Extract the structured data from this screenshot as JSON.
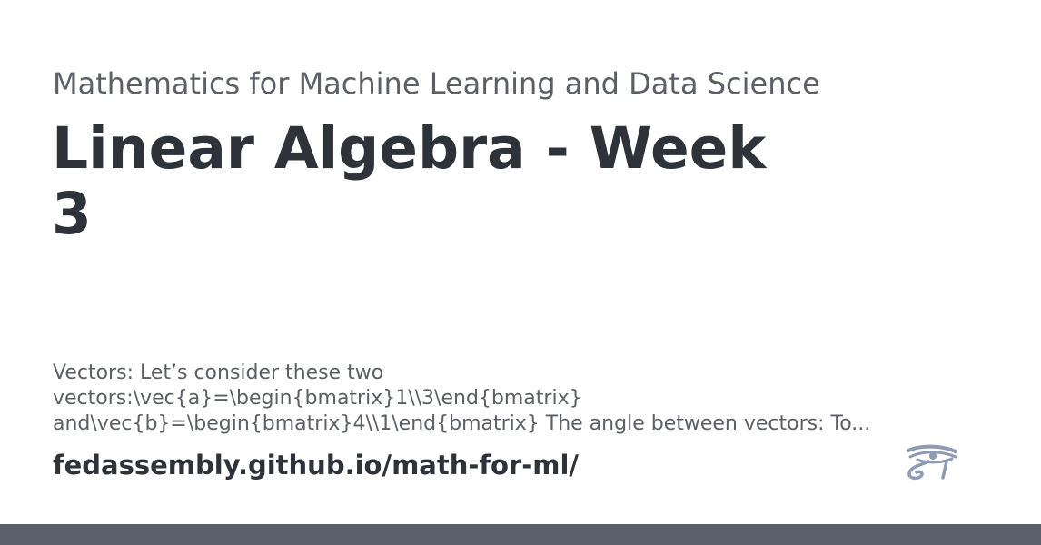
{
  "card": {
    "site_title": "Mathematics for Machine Learning and Data Science",
    "page_title": "Linear Algebra - Week 3",
    "excerpt_lines": [
      "Vectors: Let’s consider these two",
      "vectors:\\vec{a}=\\begin{bmatrix}1\\\\3\\end{bmatrix}",
      "and\\vec{b}=\\begin{bmatrix}4\\\\1\\end{bmatrix} The angle between vectors: To..."
    ],
    "site_url": "fedassembly.github.io/math-for-ml/",
    "logo_icon": "eye-of-horus-icon"
  },
  "colors": {
    "title": "#2e333a",
    "muted_text": "#5b5f66",
    "logo": "#8e9bb5",
    "bottom_bar": "#5b616c",
    "background": "#ffffff"
  }
}
